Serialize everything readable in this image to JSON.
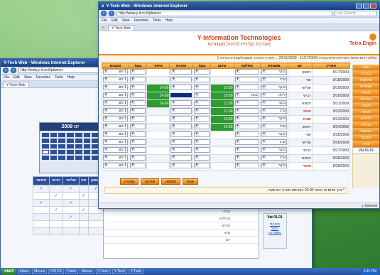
{
  "back_window": {
    "title": "Y-Tech Web - Windows Internet Explorer",
    "url": "http://www.y-it.co.il/planner",
    "menu": [
      "File",
      "Edit",
      "View",
      "Favorites",
      "Tools",
      "Help"
    ],
    "tab": "Y-Tech Web",
    "calendar_title": "2009 ינו",
    "columns": [
      "חמישי",
      "רביעי",
      "שלישי",
      "שני",
      "ראשון"
    ],
    "checks": [
      "✓",
      "✓",
      "✓",
      "✓",
      "✓",
      "✓",
      "✓",
      "✓",
      "✓",
      "✓"
    ],
    "sub_rows": [
      "נוכחי",
      "מחלקה",
      "חודש",
      "שנה",
      "יום"
    ],
    "side_panel": [
      "Vat 01.01",
      "תוכנית",
      "ניהול משמרות"
    ]
  },
  "front_window": {
    "title": "Y-Tech Web - Windows Internet Explorer",
    "url": "http://www.y-it.co.il/planner",
    "search_placeholder": "Live Search",
    "menu": [
      "File",
      "Edit",
      "View",
      "Favorites",
      "Tools",
      "Help"
    ],
    "tab": "Y-Tech Web",
    "company_en": "Y-Information Technologies",
    "company_he": "מערכת קלינית לניהול משמרות",
    "logo_text": "Tetra Engin",
    "info_line": "אלפא דרום סיכומי הגדרות חודש עבודה 11/17/2009 - 20/11/2009 ... תאריך בחירה, משמרת/עבודה בחירה 1",
    "headers": [
      "תאריך",
      "יום",
      "משמרת",
      "מחלקה",
      "עיכוב",
      "עובד",
      "הערות",
      "איחור",
      "עובד",
      "סטטוס"
    ],
    "rows": [
      {
        "date": "5/17/2009",
        "day": "ראשון",
        "shift": "בוקר",
        "dept": "",
        "hours": "",
        "employee": "",
        "note": "",
        "late": "",
        "worker": "",
        "status": "1 סוג"
      },
      {
        "date": "5/18/2009",
        "day": "שני",
        "shift": "ערב",
        "dept": "",
        "hours": "",
        "employee": "",
        "note": "",
        "late": "",
        "worker": "",
        "status": "1 סוג"
      },
      {
        "date": "5/19/2009",
        "day": "שלישי",
        "shift": "בוקר",
        "dept": "",
        "hours": "10:30",
        "employee": "",
        "note": "",
        "late": "14:00",
        "worker": "",
        "status": "1 סוג"
      },
      {
        "date": "5/20/2009",
        "day": "רביעי",
        "shift": "לילה",
        "dept": "בוקר",
        "hours": "10:30",
        "employee": "",
        "note": "",
        "late": "14:00",
        "worker": "",
        "status": "1 סוג"
      },
      {
        "date": "5/21/2009",
        "day": "חמישי",
        "shift": "בוקר",
        "dept": "",
        "hours": "11:00",
        "employee": "",
        "note": "",
        "late": "14:00",
        "worker": "",
        "status": "1 סוג"
      },
      {
        "date": "5/22/2009",
        "day": "שישי",
        "shift": "ערב",
        "dept": "",
        "hours": "11:00",
        "employee": "",
        "note": "",
        "late": "",
        "worker": "",
        "status": "1 סוג"
      },
      {
        "date": "5/23/2009",
        "day": "שבת",
        "shift": "בוקר",
        "dept": "",
        "hours": "10:00",
        "employee": "",
        "note": "",
        "late": "",
        "worker": "",
        "status": "1 סוג"
      },
      {
        "date": "5/24/2009",
        "day": "ראשון",
        "shift": "ערב",
        "dept": "",
        "hours": "10:00",
        "employee": "",
        "note": "",
        "late": "",
        "worker": "",
        "status": "1 סוג"
      },
      {
        "date": "5/25/2009",
        "day": "שני",
        "shift": "בוקר",
        "dept": "",
        "hours": "",
        "employee": "",
        "note": "",
        "late": "",
        "worker": "",
        "status": "1 סוג"
      },
      {
        "date": "5/26/2009",
        "day": "שלישי",
        "shift": "ערב",
        "dept": "",
        "hours": "",
        "employee": "",
        "note": "",
        "late": "",
        "worker": "",
        "status": "1 סוג"
      },
      {
        "date": "5/27/2009",
        "day": "רביעי",
        "shift": "בוקר",
        "dept": "",
        "hours": "",
        "employee": "",
        "note": "",
        "late": "",
        "worker": "",
        "status": "1 סוג"
      },
      {
        "date": "5/28/2009",
        "day": "חמישי",
        "shift": "ערב",
        "dept": "",
        "hours": "",
        "employee": "",
        "note": "",
        "late": "",
        "worker": "",
        "status": "1 סוג"
      },
      {
        "date": "5/29/2009",
        "day": "שישי",
        "shift": "בוקר",
        "dept": "",
        "hours": "",
        "employee": "",
        "note": "",
        "late": "",
        "worker": "",
        "status": "1 סוג"
      }
    ],
    "buttons": [
      "שמירה",
      "שליחה",
      "הדפסה",
      "אפס"
    ],
    "note": "* ציון: אדום זה הוזנת 20:00 בפורמט תאריך יום שעה",
    "side_menu": [
      "ראשי",
      "עובדים",
      "מחלקות",
      "משמרות",
      "דוחות",
      "הגדרות",
      "תקופה",
      "זמינות",
      "סידורים",
      "נוכחות",
      "חופשות",
      "הודעות",
      "עזרה"
    ],
    "side_footer": "Vat 01.01",
    "status_text": "Internet"
  },
  "taskbar": {
    "start": "start",
    "items": [
      "Inbox",
      "Micros",
      "FW Ch",
      "Flash",
      "Micros",
      "Y-Tech",
      "Y-Tech",
      "Y-Tech"
    ],
    "clock": "4:35 PM"
  }
}
